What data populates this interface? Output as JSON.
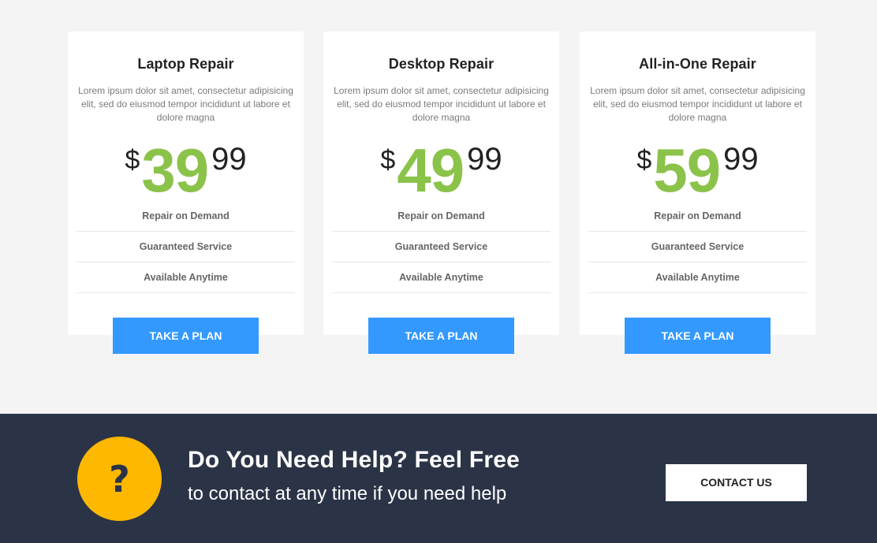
{
  "plans": [
    {
      "title": "Laptop Repair",
      "description": "Lorem ipsum dolor sit amet, consectetur adipisicing elit, sed do eiusmod tempor incididunt ut labore et dolore magna",
      "currency": "$",
      "price_whole": "39",
      "price_cents": "99",
      "features": [
        "Repair on Demand",
        "Guaranteed Service",
        "Available Anytime"
      ],
      "button_label": "TAKE A PLAN"
    },
    {
      "title": "Desktop Repair",
      "description": "Lorem ipsum dolor sit amet, consectetur adipisicing elit, sed do eiusmod tempor incididunt ut labore et dolore magna",
      "currency": "$",
      "price_whole": "49",
      "price_cents": "99",
      "features": [
        "Repair on Demand",
        "Guaranteed Service",
        "Available Anytime"
      ],
      "button_label": "TAKE A PLAN"
    },
    {
      "title": "All-in-One Repair",
      "description": "Lorem ipsum dolor sit amet, consectetur adipisicing elit, sed do eiusmod tempor incididunt ut labore et dolore magna",
      "currency": "$",
      "price_whole": "59",
      "price_cents": "99",
      "features": [
        "Repair on Demand",
        "Guaranteed Service",
        "Available Anytime"
      ],
      "button_label": "TAKE A PLAN"
    }
  ],
  "help": {
    "icon": "question-mark-icon",
    "title": "Do You Need Help? Feel Free",
    "subtitle": "to contact at any time if you need help",
    "button_label": "CONTACT US"
  },
  "colors": {
    "page_background": "#f4f4f4",
    "price_accent": "#8bc34a",
    "button_blue": "#3399ff",
    "footer_background": "#2b3446",
    "help_icon_yellow": "#ffb800"
  }
}
